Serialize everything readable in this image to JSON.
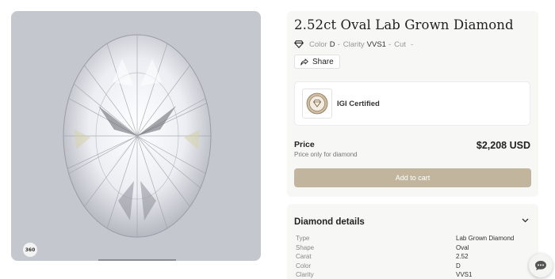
{
  "product": {
    "title": "2.52ct Oval Lab Grown Diamond",
    "specs": [
      {
        "label": "Color",
        "value": "D"
      },
      {
        "label": "Clarity",
        "value": "VVS1"
      },
      {
        "label": "Cut",
        "value": ""
      }
    ],
    "spec_separator": "-",
    "share_label": "Share",
    "badge_360": "360"
  },
  "certificate": {
    "label": "IGI Certified",
    "logo_icon": "igi-seal-icon"
  },
  "pricing": {
    "label": "Price",
    "note": "Price only for diamond",
    "value": "$2,208 USD",
    "add_to_cart_label": "Add to cart"
  },
  "details": {
    "title": "Diamond details",
    "rows": [
      {
        "key": "Type",
        "value": "Lab Grown Diamond"
      },
      {
        "key": "Shape",
        "value": "Oval"
      },
      {
        "key": "Carat",
        "value": "2.52"
      },
      {
        "key": "Color",
        "value": "D"
      },
      {
        "key": "Clarity",
        "value": "VVS1"
      }
    ]
  },
  "colors": {
    "accent": "#c1b69d",
    "image_background": "#c4c7cd",
    "panel_background": "#f7f7f6"
  }
}
